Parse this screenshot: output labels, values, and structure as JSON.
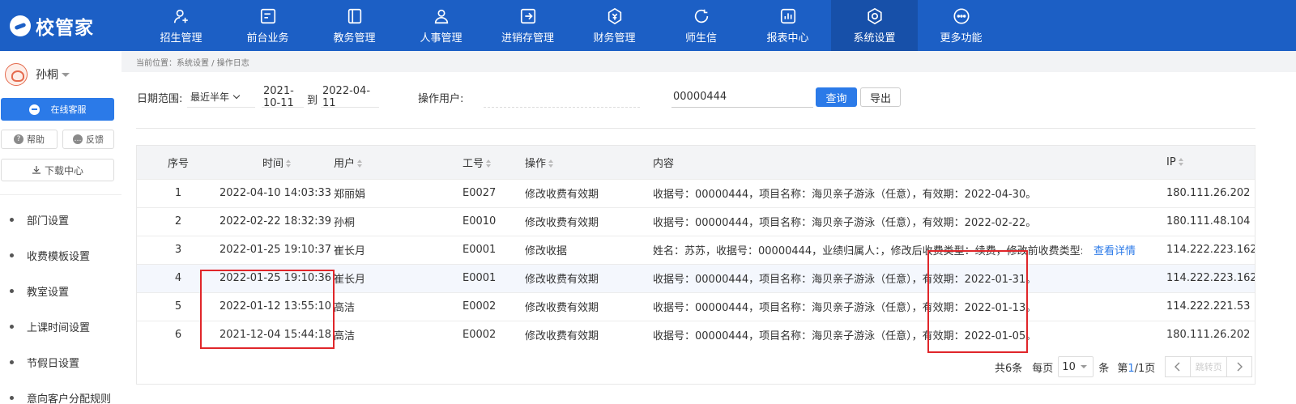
{
  "logo": {
    "text": "校管家"
  },
  "nav": [
    {
      "label": "招生管理",
      "icon": "user-plus-icon"
    },
    {
      "label": "前台业务",
      "icon": "reception-icon"
    },
    {
      "label": "教务管理",
      "icon": "book-icon"
    },
    {
      "label": "人事管理",
      "icon": "person-icon"
    },
    {
      "label": "进销存管理",
      "icon": "inventory-icon"
    },
    {
      "label": "财务管理",
      "icon": "finance-icon"
    },
    {
      "label": "师生信",
      "icon": "chat-icon"
    },
    {
      "label": "报表中心",
      "icon": "report-icon"
    },
    {
      "label": "系统设置",
      "icon": "settings-icon",
      "active": true
    },
    {
      "label": "更多功能",
      "icon": "more-icon"
    }
  ],
  "sidebar": {
    "user_name": "孙桐",
    "service_label": "在线客服",
    "help_label": "帮助",
    "feedback_label": "反馈",
    "download_label": "下载中心",
    "menu": [
      "部门设置",
      "收费模板设置",
      "教室设置",
      "上课时间设置",
      "节假日设置",
      "意向客户分配规则"
    ]
  },
  "breadcrumb": "当前位置：系统设置 / 操作日志",
  "filters": {
    "date_range_label": "日期范围:",
    "range_select": "最近半年",
    "start_date": "2021-10-11",
    "to_label": "到",
    "end_date": "2022-04-11",
    "user_label": "操作用户:",
    "keyword_value": "00000444",
    "query_label": "查询",
    "export_label": "导出"
  },
  "table": {
    "headers": {
      "no": "序号",
      "time": "时间",
      "user": "用户",
      "emp": "工号",
      "op": "操作",
      "content": "内容",
      "ip": "IP"
    },
    "rows": [
      {
        "no": "1",
        "time": "2022-04-10 14:03:33",
        "user": "郑丽娟",
        "emp": "E0027",
        "op": "修改收费有效期",
        "content": "收据号：00000444，项目名称：海贝亲子游泳（任意），有效期：2022-04-30。",
        "link": "",
        "ip": "180.111.26.202"
      },
      {
        "no": "2",
        "time": "2022-02-22 18:32:39",
        "user": "孙桐",
        "emp": "E0010",
        "op": "修改收费有效期",
        "content": "收据号：00000444，项目名称：海贝亲子游泳（任意），有效期：2022-02-22。",
        "link": "",
        "ip": "180.111.48.104"
      },
      {
        "no": "3",
        "time": "2022-01-25 19:10:37",
        "user": "崔长月",
        "emp": "E0001",
        "op": "修改收据",
        "content": "姓名：苏苏，收据号：00000444，业绩归属人：，修改后收费类型：续费，修改前收费类型:续费",
        "link": "查看详情",
        "ip": "114.222.223.162"
      },
      {
        "no": "4",
        "time": "2022-01-25 19:10:36",
        "user": "崔长月",
        "emp": "E0001",
        "op": "修改收费有效期",
        "content": "收据号：00000444，项目名称：海贝亲子游泳（任意），有效期：2022-01-31。",
        "link": "",
        "ip": "114.222.223.162"
      },
      {
        "no": "5",
        "time": "2022-01-12 13:55:10",
        "user": "高洁",
        "emp": "E0002",
        "op": "修改收费有效期",
        "content": "收据号：00000444，项目名称：海贝亲子游泳（任意），有效期：2022-01-13。",
        "link": "",
        "ip": "114.222.221.53"
      },
      {
        "no": "6",
        "time": "2021-12-04 15:44:18",
        "user": "高洁",
        "emp": "E0002",
        "op": "修改收费有效期",
        "content": "收据号：00000444，项目名称：海贝亲子游泳（任意），有效期：2022-01-05。",
        "link": "",
        "ip": "180.111.26.202"
      }
    ]
  },
  "pager": {
    "total": "共6条",
    "per_page_label": "每页",
    "per_page_value": "10",
    "unit": "条",
    "page_prefix": "第",
    "page_cur": "1",
    "page_suffix": "/1页",
    "jump_placeholder": "跳转页"
  },
  "colors": {
    "brand": "#1c5fc5",
    "primary_button": "#2b7ae8",
    "annotation": "#e0262a"
  }
}
